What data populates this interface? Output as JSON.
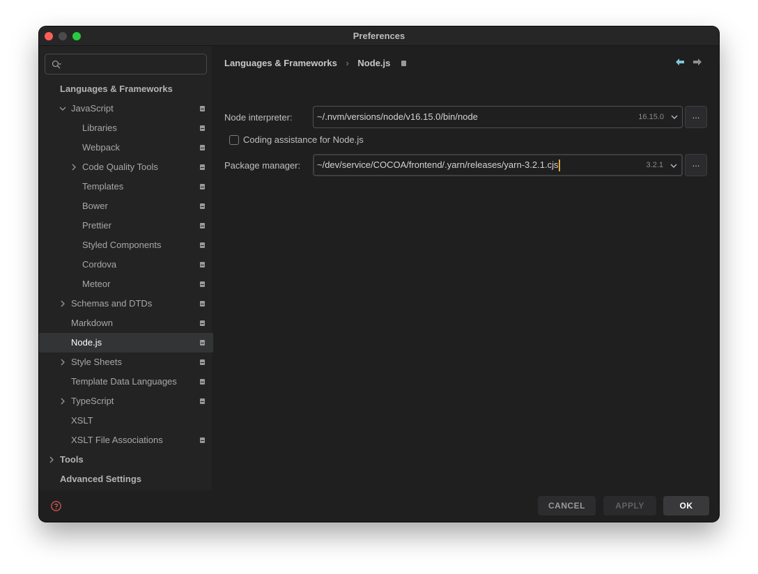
{
  "window": {
    "title": "Preferences"
  },
  "sidebar": {
    "search_placeholder": "",
    "items": [
      {
        "label": "Languages & Frameworks",
        "level": 0,
        "bold": true,
        "arrow": "none",
        "project_icon": false
      },
      {
        "label": "JavaScript",
        "level": 1,
        "arrow": "down",
        "project_icon": true
      },
      {
        "label": "Libraries",
        "level": 2,
        "arrow": "none",
        "project_icon": true
      },
      {
        "label": "Webpack",
        "level": 2,
        "arrow": "none",
        "project_icon": true
      },
      {
        "label": "Code Quality Tools",
        "level": 2,
        "arrow": "right",
        "project_icon": true
      },
      {
        "label": "Templates",
        "level": 2,
        "arrow": "none",
        "project_icon": true
      },
      {
        "label": "Bower",
        "level": 2,
        "arrow": "none",
        "project_icon": true
      },
      {
        "label": "Prettier",
        "level": 2,
        "arrow": "none",
        "project_icon": true
      },
      {
        "label": "Styled Components",
        "level": 2,
        "arrow": "none",
        "project_icon": true
      },
      {
        "label": "Cordova",
        "level": 2,
        "arrow": "none",
        "project_icon": true
      },
      {
        "label": "Meteor",
        "level": 2,
        "arrow": "none",
        "project_icon": true
      },
      {
        "label": "Schemas and DTDs",
        "level": 1,
        "arrow": "right",
        "project_icon": true
      },
      {
        "label": "Markdown",
        "level": 1,
        "arrow": "none",
        "project_icon": true
      },
      {
        "label": "Node.js",
        "level": 1,
        "arrow": "none",
        "project_icon": true,
        "selected": true
      },
      {
        "label": "Style Sheets",
        "level": 1,
        "arrow": "right",
        "project_icon": true
      },
      {
        "label": "Template Data Languages",
        "level": 1,
        "arrow": "none",
        "project_icon": true
      },
      {
        "label": "TypeScript",
        "level": 1,
        "arrow": "right",
        "project_icon": true
      },
      {
        "label": "XSLT",
        "level": 1,
        "arrow": "none",
        "project_icon": false
      },
      {
        "label": "XSLT File Associations",
        "level": 1,
        "arrow": "none",
        "project_icon": true
      },
      {
        "label": "Tools",
        "level": 0,
        "bold": true,
        "arrow": "right",
        "project_icon": false
      },
      {
        "label": "Advanced Settings",
        "level": 0,
        "bold": true,
        "arrow": "none",
        "project_icon": false
      }
    ]
  },
  "breadcrumb": {
    "parent": "Languages & Frameworks",
    "separator": "›",
    "current": "Node.js"
  },
  "form": {
    "interpreter": {
      "label": "Node interpreter:",
      "value": "~/.nvm/versions/node/v16.15.0/bin/node",
      "version": "16.15.0"
    },
    "coding_assistance": {
      "label": "Coding assistance for Node.js",
      "checked": false
    },
    "package_manager": {
      "label": "Package manager:",
      "value": "~/dev/service/COCOA/frontend/.yarn/releases/yarn-3.2.1.cjs",
      "version": "3.2.1"
    },
    "browse_label": "..."
  },
  "buttons": {
    "cancel": "CANCEL",
    "apply": "APPLY",
    "ok": "OK"
  },
  "colors": {
    "accent_back_arrow": "#7fc8d6",
    "caret": "#e5a63a",
    "help_icon": "#e05555",
    "selection": "#333436"
  }
}
